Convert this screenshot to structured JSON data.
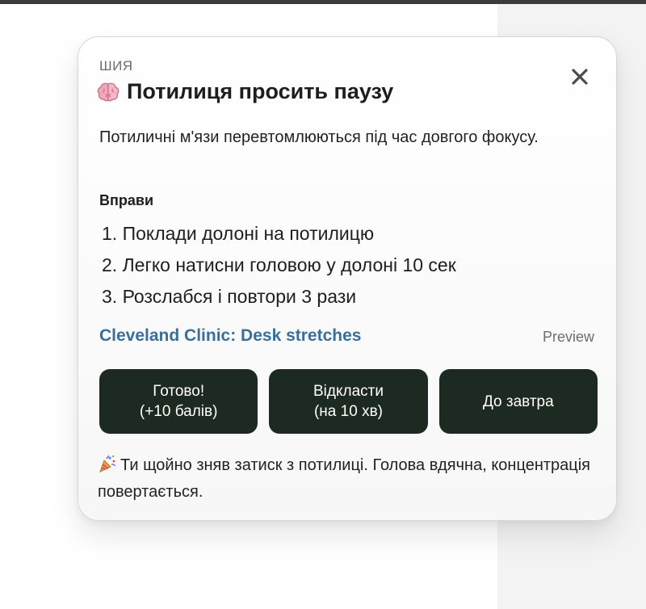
{
  "colors": {
    "button_bg": "#1d2a21",
    "link": "#3a6e9c",
    "muted_text": "#6b6e6b"
  },
  "card": {
    "category": "ШИЯ",
    "title_icon": "brain-icon",
    "title": "Потилиця просить паузу",
    "close_icon": "close-icon",
    "description": "Потиличні м'язи перевтомлюються під час довгого фокусу.",
    "exercises_heading": "Вправи",
    "exercises": [
      "1. Поклади долоні на потилицю",
      "2. Легко натисни головою у долоні 10 сек",
      "3. Розслабся і повтори 3 рази"
    ],
    "source_link": "Cleveland Clinic: Desk stretches",
    "preview_label": "Preview",
    "buttons": {
      "done_line1": "Готово!",
      "done_line2": "(+10 балів)",
      "snooze_line1": "Відкласти",
      "snooze_line2": "(на 10 хв)",
      "tomorrow": "До завтра"
    },
    "feedback_icon": "party-popper-icon",
    "feedback": "Ти щойно зняв затиск з потилиці. Голова вдячна, концентрація повертається."
  }
}
